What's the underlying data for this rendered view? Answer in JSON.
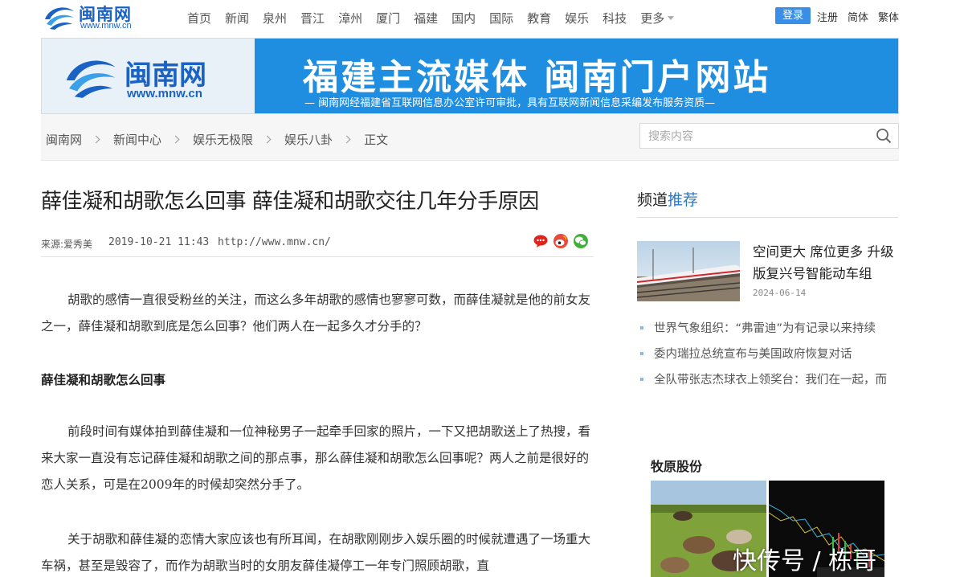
{
  "header": {
    "logo_cn": "闽南网",
    "logo_en": "www.mnw.cn",
    "nav": [
      "首页",
      "新闻",
      "泉州",
      "晋江",
      "漳州",
      "厦门",
      "福建",
      "国内",
      "国际",
      "教育",
      "娱乐",
      "科技",
      "更多"
    ],
    "login": "登录",
    "register": "注册",
    "simplified": "简体",
    "traditional": "繁体"
  },
  "banner": {
    "logo_cn": "闽南网",
    "logo_en": "www.mnw.cn",
    "slogan": "福建主流媒体   闽南门户网站",
    "subtitle": "— 闽南网经福建省互联网信息办公室许可审批，具有互联网新闻信息采编发布服务资质—"
  },
  "breadcrumb": [
    "闽南网",
    "新闻中心",
    "娱乐无极限",
    "娱乐八卦",
    "正文"
  ],
  "search": {
    "placeholder": "搜索内容"
  },
  "article": {
    "title": "薛佳凝和胡歌怎么回事 薛佳凝和胡歌交往几年分手原因",
    "source": "来源:爱秀美",
    "date": "2019-10-21 11:43",
    "url": "http://www.mnw.cn/",
    "paragraphs": [
      "胡歌的感情一直很受粉丝的关注，而这么多年胡歌的感情也寥寥可数，而薛佳凝就是他的前女友之一，薛佳凝和胡歌到底是怎么回事？他们两人在一起多久才分手的？",
      "前段时间有媒体拍到薛佳凝和一位神秘男子一起牵手回家的照片，一下又把胡歌送上了热搜，看来大家一直没有忘记薛佳凝和胡歌之间的那点事，那么薛佳凝和胡歌怎么回事呢？两人之前是很好的恋人关系，可是在2009年的时候却突然分手了。",
      "关于胡歌和薛佳凝的恋情大家应该也有所耳闻，在胡歌刚刚步入娱乐圈的时候就遭遇了一场重大车祸，甚至是毁容了，而作为胡歌当时的女朋友薛佳凝停工一年专门照顾胡歌，直"
    ],
    "subhead": "薛佳凝和胡歌怎么回事"
  },
  "sidebar": {
    "heading_a": "频道",
    "heading_b": "推荐",
    "featured_title": "空间更大 席位更多 升级版复兴号智能动车组",
    "featured_date": "2024-06-14",
    "items": [
      "世界气象组织：“弗雷迪”为有记录以来持续",
      "委内瑞拉总统宣布与美国政府恢复对话",
      "全队带张志杰球衣上领奖台：我们在一起，而"
    ],
    "ad_title": "牧原股份",
    "watermark": "快传号 / 栋哥"
  },
  "colors": {
    "brand": "#1a62c4",
    "banner_blue": "#1f8de0",
    "accent": "#2b78c5"
  },
  "icons": [
    "swirl-logo-icon",
    "search-icon",
    "comment-icon",
    "weibo-icon",
    "wechat-icon"
  ]
}
